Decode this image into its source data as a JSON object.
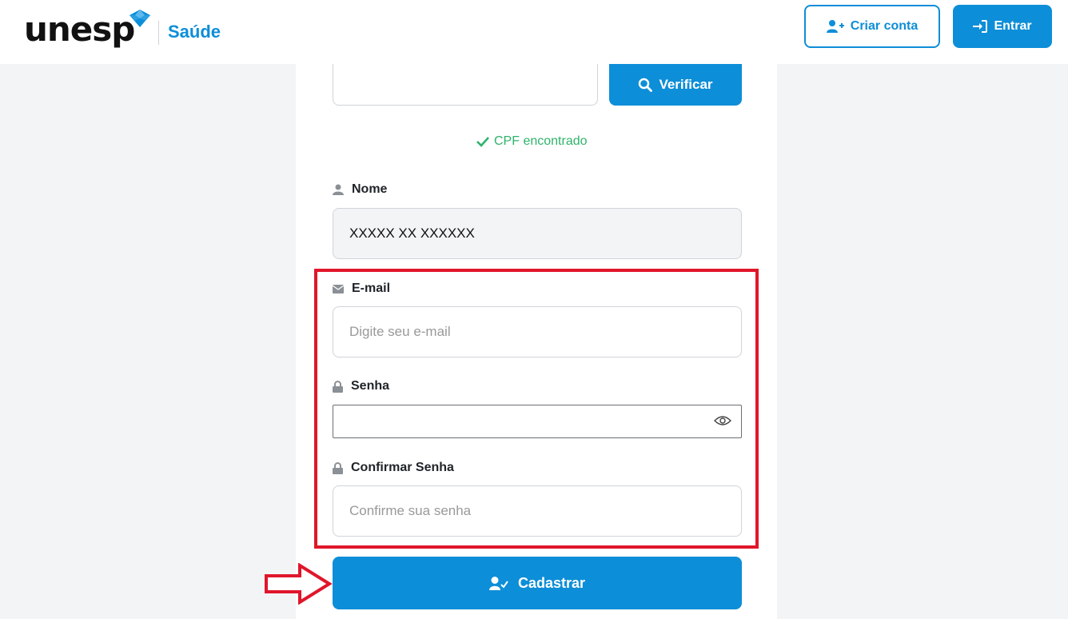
{
  "header": {
    "logo_text": "unesp",
    "brand_sub": "Saúde",
    "create_account_label": "Criar conta",
    "login_label": "Entrar"
  },
  "form": {
    "cpf": {
      "value": "",
      "verify_label": "Verificar",
      "status_text": "CPF encontrado"
    },
    "name": {
      "label": "Nome",
      "value": "XXXXX XX XXXXXX"
    },
    "email": {
      "label": "E-mail",
      "placeholder": "Digite seu e-mail"
    },
    "password": {
      "label": "Senha",
      "value": ""
    },
    "confirm_password": {
      "label": "Confirmar Senha",
      "placeholder": "Confirme sua senha"
    },
    "submit_label": "Cadastrar"
  },
  "colors": {
    "primary": "#0d8ed8",
    "success": "#2fb36b",
    "highlight": "#e0162b"
  }
}
